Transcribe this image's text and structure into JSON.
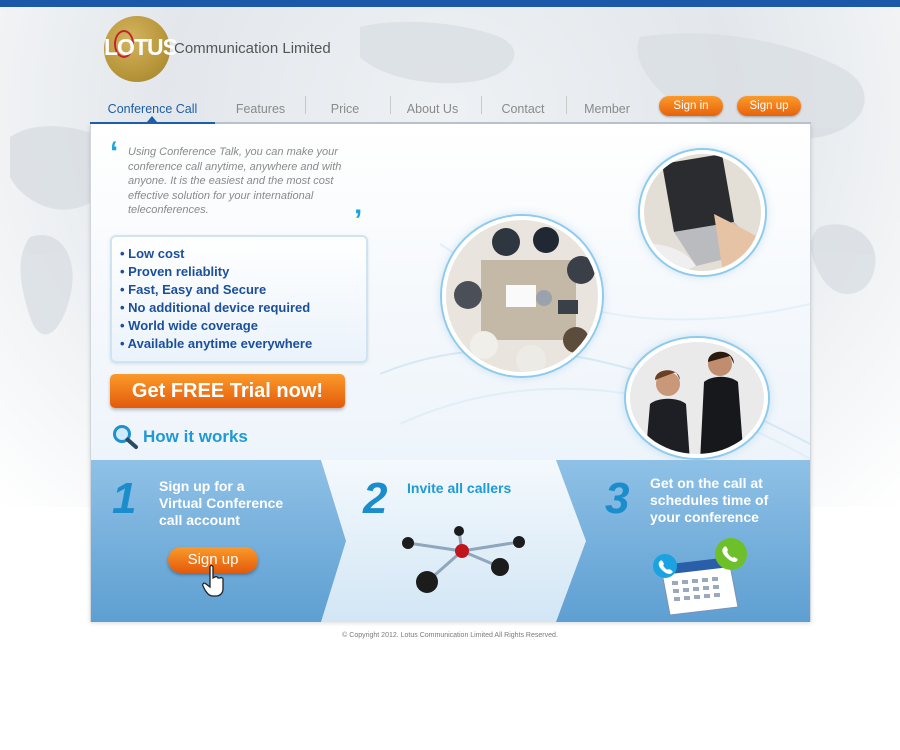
{
  "header": {
    "logo_text": "LOTUS",
    "company_name": "Communication Limited"
  },
  "nav": {
    "items": [
      {
        "label": "Conference Call",
        "active": true
      },
      {
        "label": "Features",
        "active": false
      },
      {
        "label": "Price",
        "active": false
      },
      {
        "label": "About Us",
        "active": false
      },
      {
        "label": "Contact",
        "active": false
      },
      {
        "label": "Member",
        "active": false
      }
    ],
    "sign_in": "Sign in",
    "sign_up": "Sign up"
  },
  "intro": {
    "text": "Using Conference Talk, you can make your conference call anytime, anywhere and with anyone. It is the easiest and the most cost effective solution for your international teleconferences."
  },
  "benefits": [
    "• Low cost",
    "• Proven reliablity",
    "• Fast, Easy and Secure",
    "• No additional device required",
    "• World wide coverage",
    "• Available anytime everywhere"
  ],
  "cta": {
    "trial_label": "Get FREE Trial now!"
  },
  "how_it_works": {
    "title": "How it works",
    "steps": [
      {
        "number": "1",
        "text_lines": [
          "Sign up for a",
          "Virtual Conference",
          "call account"
        ],
        "button": "Sign up"
      },
      {
        "number": "2",
        "text_lines": [
          "Invite all callers"
        ]
      },
      {
        "number": "3",
        "text_lines": [
          "Get on the call at",
          "schedules time of",
          "your conference"
        ]
      }
    ]
  },
  "footer": {
    "copyright": "© Copyright 2012. Lotus Communication Limited All Rights Reserved."
  },
  "colors": {
    "brand_blue": "#1c5ea9",
    "accent_orange": "#f07a1a",
    "logo_gold": "#b8963a"
  },
  "icons": [
    "search-icon",
    "hand-cursor-icon",
    "phone-icon",
    "calendar-icon",
    "network-icon"
  ]
}
